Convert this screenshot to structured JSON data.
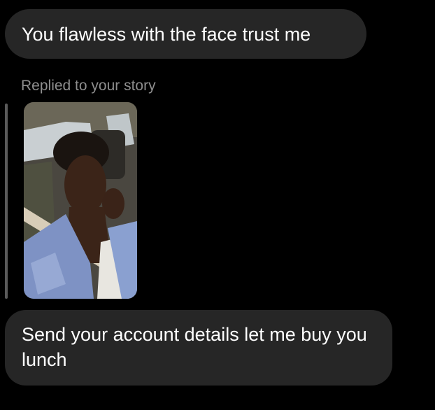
{
  "messages": {
    "first": "You flawless with the face trust me",
    "reply_label": "Replied to your story",
    "second": "Send your account details let me buy you lunch"
  },
  "story": {
    "description": "story-photo"
  },
  "colors": {
    "background": "#000000",
    "bubble": "#262626",
    "secondary_text": "#8e8e8e",
    "reply_bar": "#5a5a5a"
  }
}
